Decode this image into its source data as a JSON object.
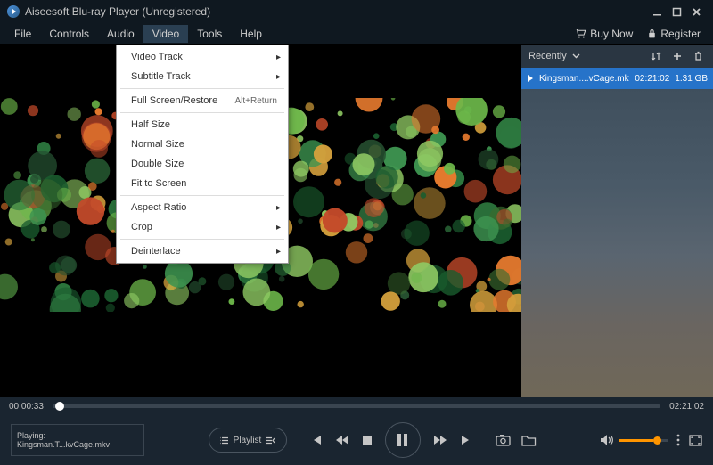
{
  "titlebar": {
    "app_title": "Aiseesoft Blu-ray Player (Unregistered)"
  },
  "menubar": {
    "items": [
      "File",
      "Controls",
      "Audio",
      "Video",
      "Tools",
      "Help"
    ],
    "active_index": 3,
    "buy_now": "Buy Now",
    "register": "Register"
  },
  "dropdown": {
    "items": [
      {
        "label": "Video Track",
        "submenu": true
      },
      {
        "label": "Subtitle Track",
        "submenu": true
      },
      {
        "sep": true
      },
      {
        "label": "Full Screen/Restore",
        "shortcut": "Alt+Return"
      },
      {
        "sep": true
      },
      {
        "label": "Half Size"
      },
      {
        "label": "Normal Size"
      },
      {
        "label": "Double Size"
      },
      {
        "label": "Fit to Screen"
      },
      {
        "sep": true
      },
      {
        "label": "Aspect Ratio",
        "submenu": true
      },
      {
        "label": "Crop",
        "submenu": true
      },
      {
        "sep": true
      },
      {
        "label": "Deinterlace",
        "submenu": true
      }
    ]
  },
  "playlist": {
    "header_label": "Recently",
    "items": [
      {
        "name": "Kingsman....vCage.mkv",
        "duration": "02:21:02",
        "size": "1.31 GB"
      }
    ]
  },
  "progress": {
    "current": "00:00:33",
    "total": "02:21:02"
  },
  "now_playing": {
    "label": "Playing:",
    "file": "Kingsman.T...kvCage.mkv"
  },
  "playlist_btn": "Playlist"
}
